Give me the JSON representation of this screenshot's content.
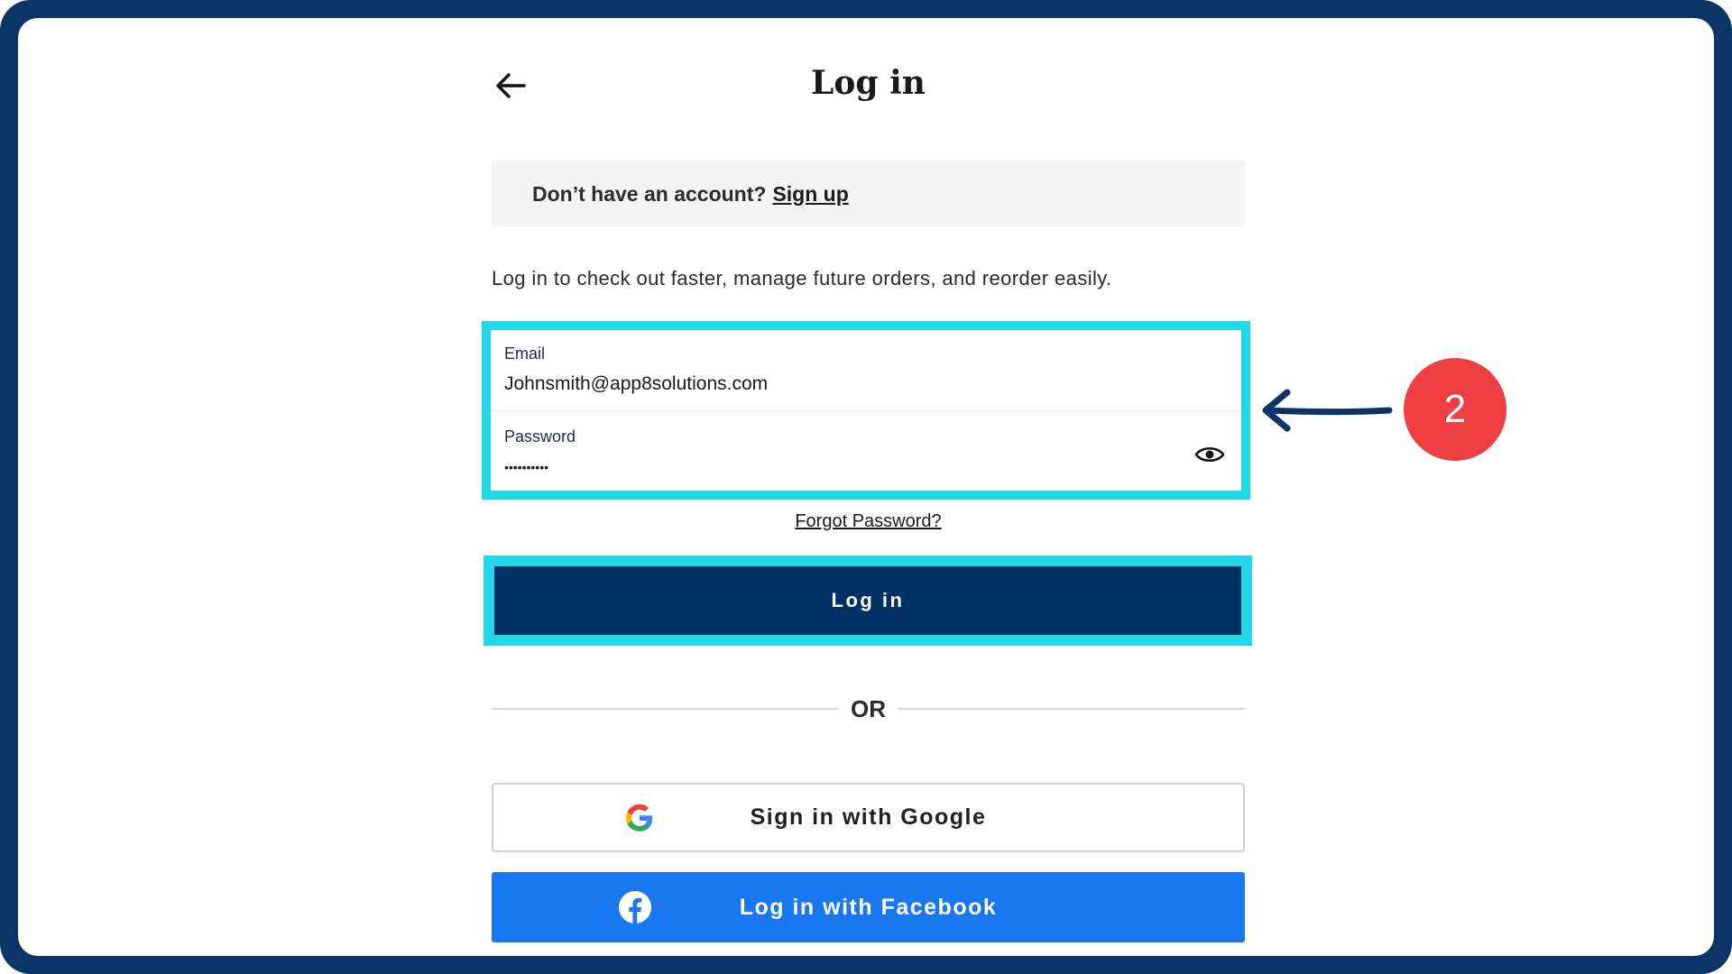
{
  "header": {
    "title": "Log in"
  },
  "signup_banner": {
    "prompt": "Don’t have an account?",
    "link_label": "Sign up"
  },
  "intro_text": "Log in to check out faster, manage future orders, and reorder easily.",
  "form": {
    "email": {
      "label": "Email",
      "value": "Johnsmith@app8solutions.com"
    },
    "password": {
      "label": "Password",
      "value": "••••••••••"
    },
    "forgot_password_label": "Forgot Password?",
    "login_button_label": "Log in"
  },
  "divider_label": "OR",
  "social": {
    "google_label": "Sign in with Google",
    "facebook_label": "Log in with Facebook"
  },
  "annotation": {
    "step_number": "2"
  },
  "colors": {
    "frame": "#0b3566",
    "highlight": "#22d8e6",
    "primary_button": "#003166",
    "facebook": "#1a77f2",
    "step_badge": "#ee4042"
  },
  "icons": {
    "back": "arrow-left-icon",
    "password_toggle": "eye-icon",
    "google": "google-icon",
    "facebook": "facebook-icon",
    "annotation": "annotation-arrow-icon"
  }
}
